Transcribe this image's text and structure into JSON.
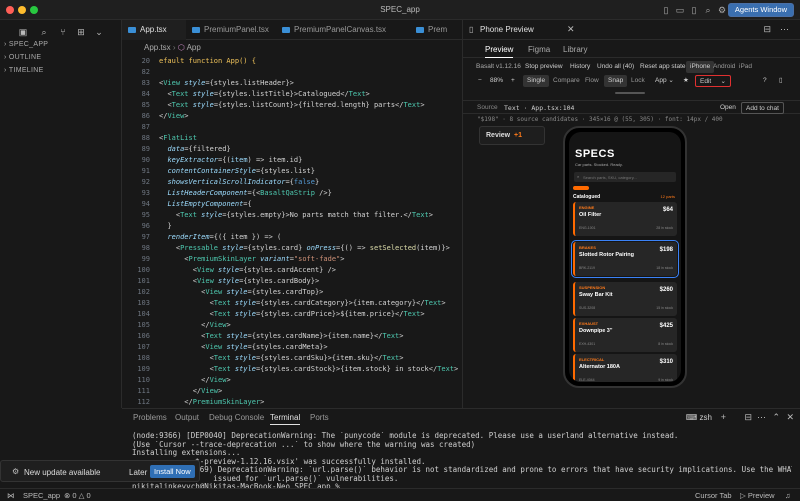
{
  "window": {
    "title": "SPEC_app",
    "agents_label": "Agents Window"
  },
  "sidebar": {
    "sections": [
      "SPEC_APP",
      "OUTLINE",
      "TIMELINE"
    ]
  },
  "editor": {
    "tabs": [
      "App.tsx",
      "PremiumPanel.tsx",
      "PremiumPanelCanvas.tsx",
      "Prem"
    ],
    "breadcrumb": [
      "App.tsx",
      "App"
    ],
    "line_numbers": [
      "20",
      "82",
      "83",
      "84",
      "85",
      "86",
      "87",
      "88",
      "89",
      "90",
      "91",
      "92",
      "93",
      "94",
      "95",
      "96",
      "97",
      "98",
      "99",
      "100",
      "101",
      "102",
      "103",
      "104",
      "105",
      "106",
      "107",
      "108",
      "109",
      "110",
      "111",
      "112",
      "113"
    ]
  },
  "panel": {
    "tabs": [
      "Problems",
      "Output",
      "Debug Console",
      "Terminal",
      "Ports"
    ],
    "shell": "zsh",
    "terminal_lines": [
      "(node:9366) [DEP0040] DeprecationWarning: The `punycode` module is deprecated. Please use a userland alternative instead.",
      "(Use `Cursor --trace-deprecation ...` to show where the warning was created)",
      "Installing extensions...",
      "              t-preview-1.12.16.vsix' was successfully installed.",
      "              169) DeprecationWarning: `url.parse()` behavior is not standardized and prone to errors that have security implications. Use the WHATWG URL API inst",
      "                  issued for `url.parse()` vulnerabilities.",
      "nikitalinkevych@Nikitas-MacBook-Neo SPEC_app %"
    ]
  },
  "notification": {
    "text": "New update available",
    "later": "Later",
    "install": "Install Now"
  },
  "statusbar": {
    "branch": "SPEC_app",
    "errors": "0",
    "warnings": "0",
    "cursor_tab": "Cursor Tab",
    "preview": "Preview"
  },
  "preview": {
    "title": "Phone Preview",
    "tabs": [
      "Preview",
      "Figma",
      "Library"
    ],
    "toolbar1": [
      "Basalt v1.12.16",
      "Stop preview",
      "History",
      "Undo all (40)",
      "Reset app state",
      "iPhone",
      "Android",
      "iPad"
    ],
    "toolbar2": [
      "−",
      "88%",
      "+",
      "Single",
      "Compare",
      "Flow",
      "Snap",
      "Lock",
      "App",
      "Edit",
      "?"
    ],
    "source_row": {
      "label": "Source",
      "file": "Text · App.tsx:104",
      "open": "Open",
      "add": "Add to chat"
    },
    "info": "\"$198\" · 8 source candidates · 345×16 @ (55, 305) · font: 14px / 400",
    "review": {
      "label": "Review",
      "count": "+1"
    }
  },
  "phone_app": {
    "brand": "SPECS",
    "tagline": "Car parts. Stocked. Ready.",
    "search_placeholder": "Search parts, SKU, category...",
    "list_title": "Catalogued",
    "list_count": "12 parts",
    "items": [
      {
        "category": "ENGINE",
        "name": "Oil Filter",
        "sku": "ENG-1001",
        "price": "$64",
        "stock": "28 in stock"
      },
      {
        "category": "BRAKES",
        "name": "Slotted Rotor Pairing",
        "sku": "BRK-2119",
        "price": "$198",
        "stock": "18 in stock"
      },
      {
        "category": "SUSPENSION",
        "name": "Sway Bar Kit",
        "sku": "SUS-3208",
        "price": "$260",
        "stock": "15 in stock"
      },
      {
        "category": "EXHAUST",
        "name": "Downpipe 3\"",
        "sku": "EXH-4301",
        "price": "$425",
        "stock": "8 in stock"
      },
      {
        "category": "ELECTRICAL",
        "name": "Alternator 180A",
        "sku": "ELE-4044",
        "price": "$310",
        "stock": "9 in stock"
      }
    ]
  },
  "colors": {
    "accent": "#ff6a00",
    "selection": "#3b82f6",
    "editor_bg": "#181818"
  }
}
